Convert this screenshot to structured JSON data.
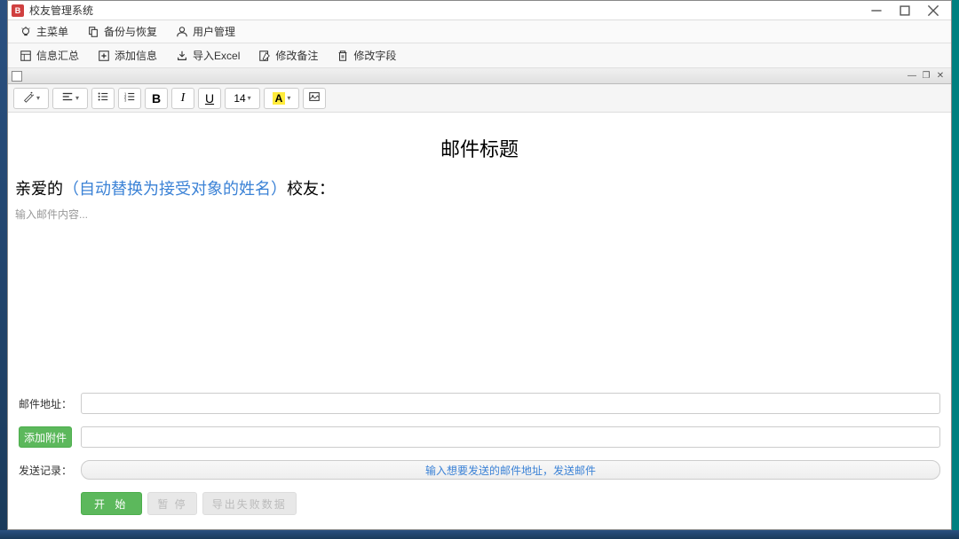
{
  "window": {
    "title": "校友管理系统",
    "appIconText": "B"
  },
  "menu": {
    "main": "主菜单",
    "backup": "备份与恢复",
    "user": "用户管理"
  },
  "toolbar": {
    "summary": "信息汇总",
    "add": "添加信息",
    "import": "导入Excel",
    "editNote": "修改备注",
    "editField": "修改字段"
  },
  "editor": {
    "fontSize": "14",
    "fontColorLetter": "A",
    "highlightLetter": "A"
  },
  "mail": {
    "title": "邮件标题",
    "greetingPrefix": "亲爱的",
    "greetingPlaceholder": "（自动替换为接受对象的姓名）",
    "greetingSuffix": "校友：",
    "bodyPlaceholder": "输入邮件内容..."
  },
  "form": {
    "addressLabel": "邮件地址：",
    "addressValue": "",
    "attachBtn": "添加附件",
    "attachValue": "",
    "logLabel": "发送记录：",
    "progressText": "输入想要发送的邮件地址，发送邮件",
    "startBtn": "开 始",
    "pauseBtn": "暂 停",
    "exportBtn": "导出失败数据"
  }
}
